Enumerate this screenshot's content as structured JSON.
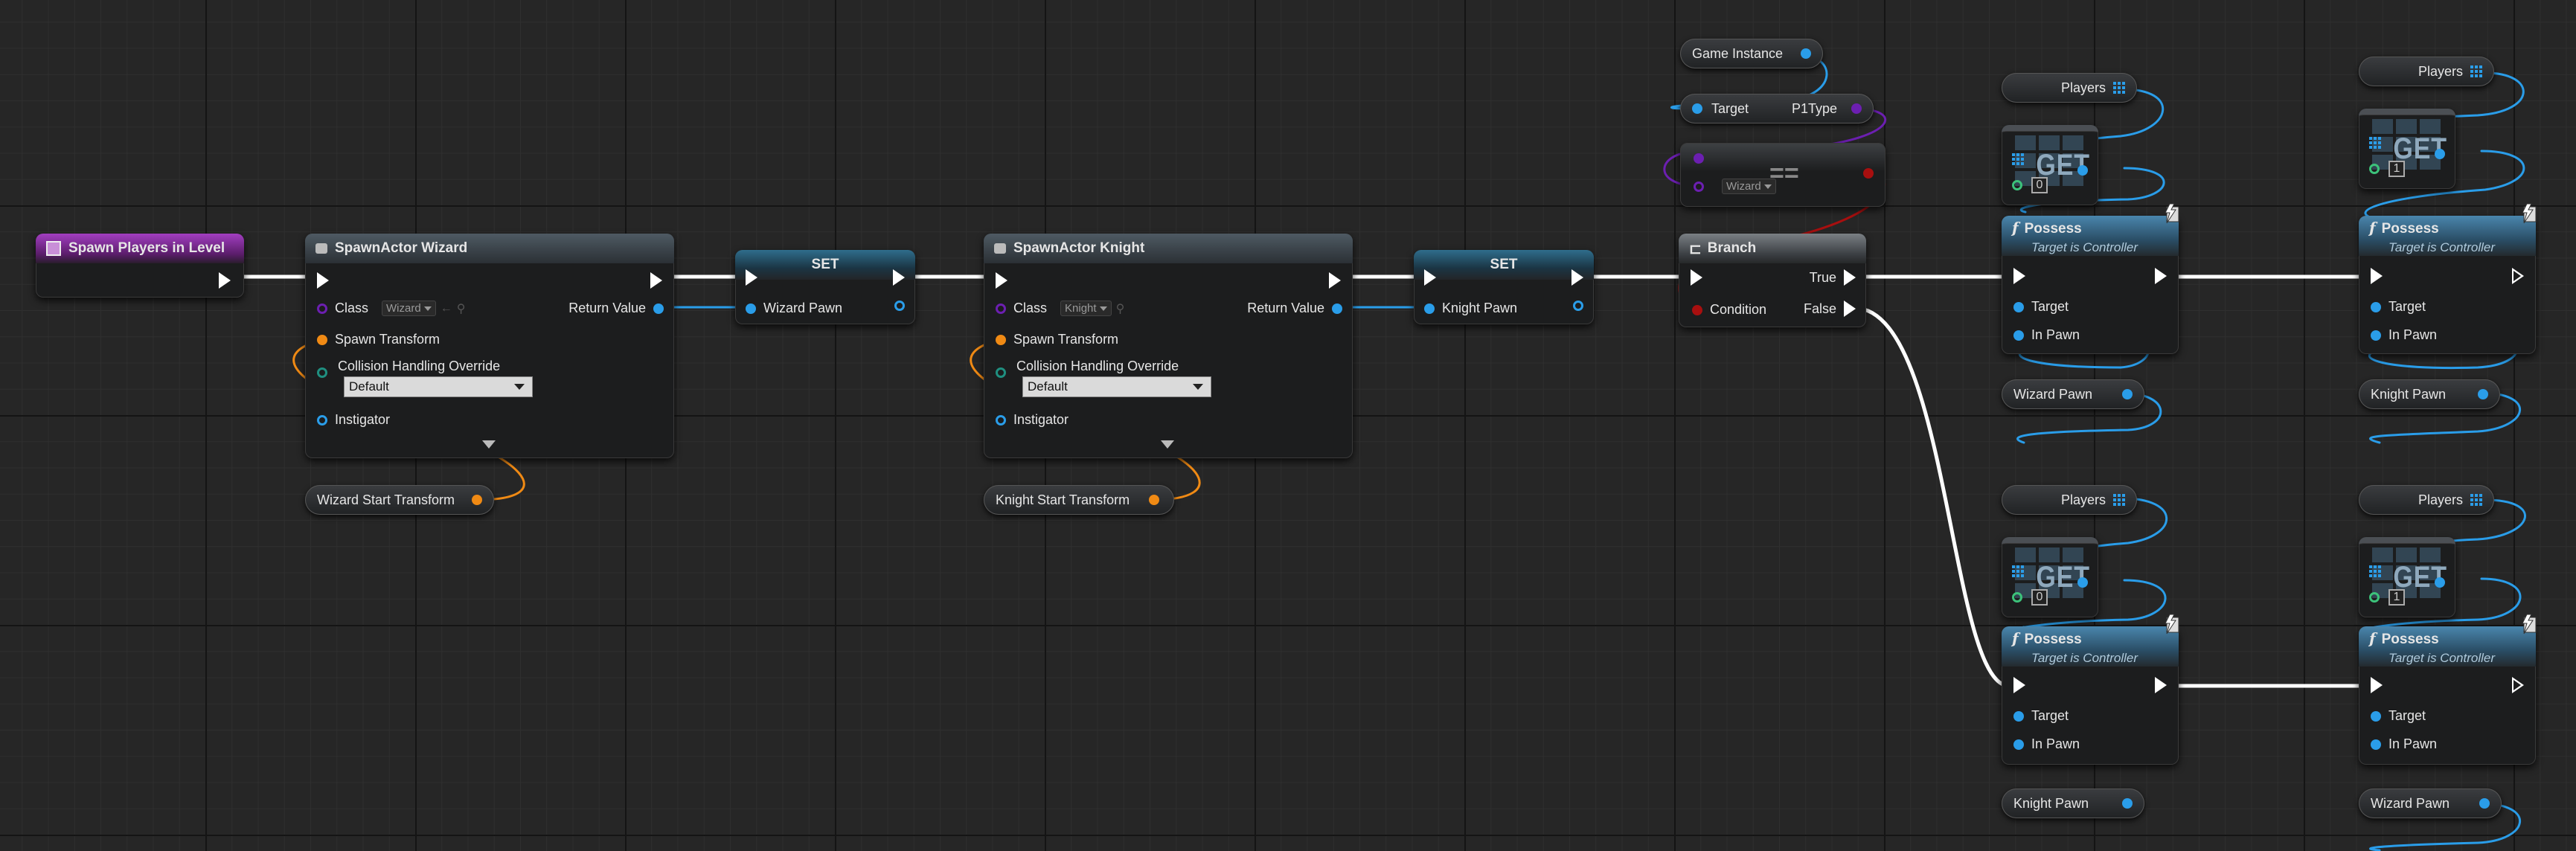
{
  "graph": {
    "event": {
      "title": "Spawn Players in Level"
    },
    "spawn_wizard": {
      "title": "SpawnActor Wizard",
      "class_label": "Class",
      "class_value": "Wizard",
      "return_label": "Return Value",
      "spawn_transform_label": "Spawn Transform",
      "collision_label": "Collision Handling Override",
      "collision_value": "Default",
      "instigator_label": "Instigator"
    },
    "wizard_transform": {
      "label": "Wizard Start Transform"
    },
    "set_wizard": {
      "title": "SET",
      "pin_label": "Wizard Pawn"
    },
    "spawn_knight": {
      "title": "SpawnActor Knight",
      "class_label": "Class",
      "class_value": "Knight",
      "return_label": "Return Value",
      "spawn_transform_label": "Spawn Transform",
      "collision_label": "Collision Handling Override",
      "collision_value": "Default",
      "instigator_label": "Instigator"
    },
    "knight_transform": {
      "label": "Knight Start Transform"
    },
    "set_knight": {
      "title": "SET",
      "pin_label": "Knight Pawn"
    },
    "game_instance": {
      "label": "Game Instance"
    },
    "p1type": {
      "target_label": "Target",
      "value_label": "P1Type"
    },
    "equals": {
      "enum_value": "Wizard",
      "symbol": "=="
    },
    "branch": {
      "title": "Branch",
      "true_label": "True",
      "false_label": "False",
      "condition_label": "Condition"
    },
    "players_label": "Players",
    "get_label": "GET",
    "possess": {
      "title": "Possess",
      "subtitle": "Target is Controller",
      "target_label": "Target",
      "inpawn_label": "In Pawn"
    },
    "index_zero": "0",
    "index_one": "1",
    "pawn_refs": {
      "top_left": "Wizard Pawn",
      "top_right": "Knight Pawn",
      "bottom_left": "Knight Pawn",
      "bottom_right": "Wizard Pawn"
    }
  },
  "colors": {
    "exec": "#ffffff",
    "object": "#2a9de9",
    "transform": "#f08a14",
    "class": "#6c1fb1",
    "byte": "#1f8f80",
    "bool": "#a80f0f",
    "int": "#3cc27a"
  }
}
